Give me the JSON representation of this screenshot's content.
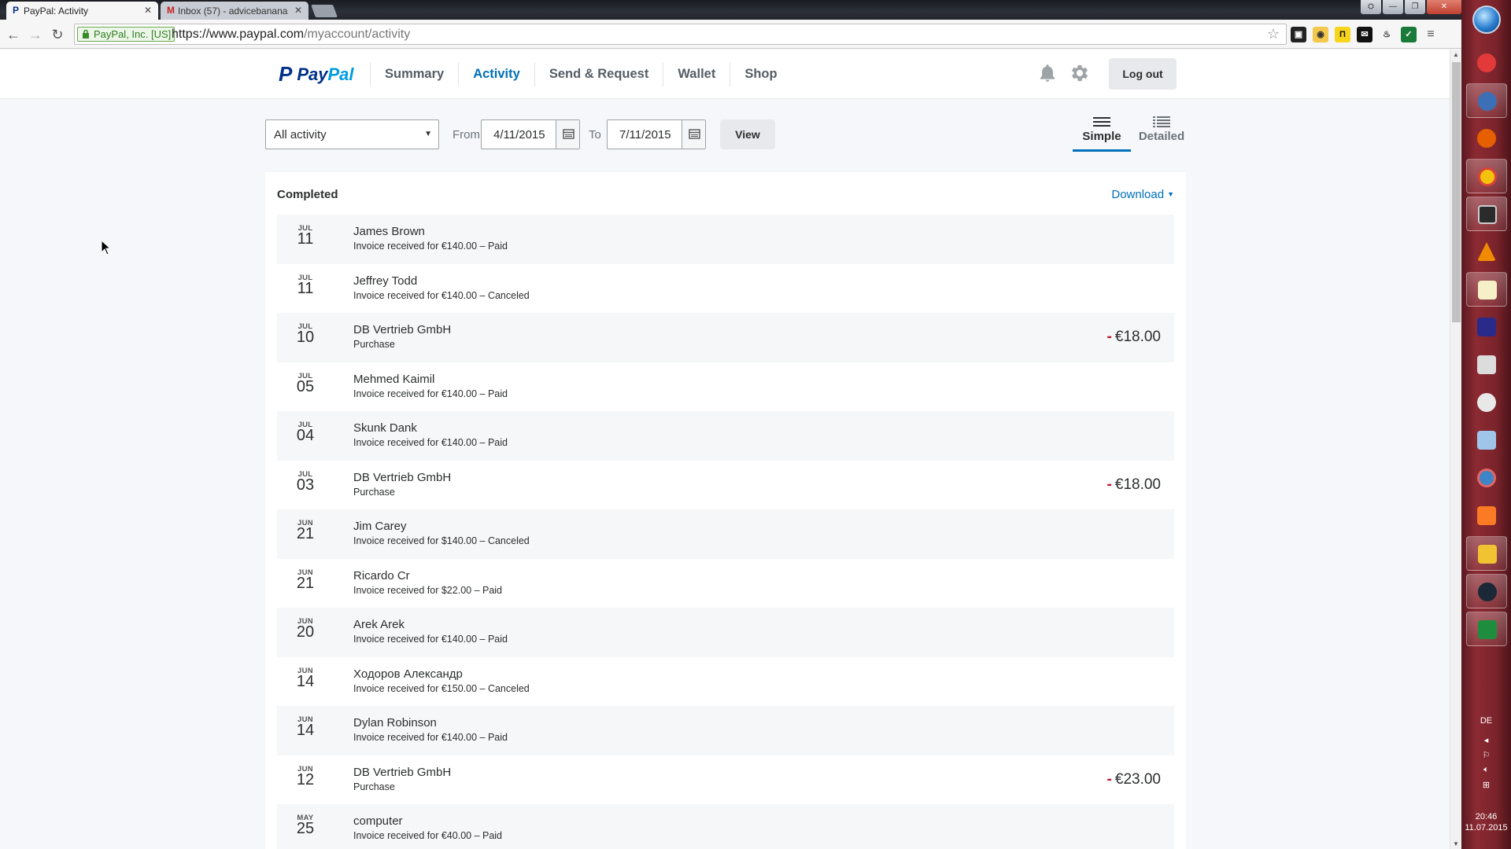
{
  "browser": {
    "tabs": [
      {
        "title": "PayPal: Activity",
        "favicon": "paypal-favicon",
        "active": true
      },
      {
        "title": "Inbox (57) - advicebanana",
        "favicon": "gmail-favicon",
        "active": false
      }
    ],
    "ev_certificate": "PayPal, Inc. [US]",
    "url_host": "https://www.paypal.com",
    "url_path": "/myaccount/activity"
  },
  "header": {
    "logo_text_a": "Pay",
    "logo_text_b": "Pal",
    "nav": [
      "Summary",
      "Activity",
      "Send & Request",
      "Wallet",
      "Shop"
    ],
    "active_nav": "Activity",
    "logout_label": "Log out"
  },
  "filters": {
    "activity_type": "All activity",
    "from_label": "From",
    "from_date": "4/11/2015",
    "to_label": "To",
    "to_date": "7/11/2015",
    "view_label": "View",
    "view_modes": [
      "Simple",
      "Detailed"
    ],
    "active_view_mode": "Simple"
  },
  "activity": {
    "section_title": "Completed",
    "download_label": "Download",
    "transactions": [
      {
        "month": "JUL",
        "day": "11",
        "name": "James Brown",
        "desc": "Invoice received for €140.00 – Paid",
        "amount": ""
      },
      {
        "month": "JUL",
        "day": "11",
        "name": "Jeffrey Todd",
        "desc": "Invoice received for €140.00 – Canceled",
        "amount": ""
      },
      {
        "month": "JUL",
        "day": "10",
        "name": "DB Vertrieb GmbH",
        "desc": "Purchase",
        "amount": "€18.00",
        "sign": "-"
      },
      {
        "month": "JUL",
        "day": "05",
        "name": "Mehmed Kaimil",
        "desc": "Invoice received for €140.00 – Paid",
        "amount": ""
      },
      {
        "month": "JUL",
        "day": "04",
        "name": "Skunk Dank",
        "desc": "Invoice received for €140.00 – Paid",
        "amount": ""
      },
      {
        "month": "JUL",
        "day": "03",
        "name": "DB Vertrieb GmbH",
        "desc": "Purchase",
        "amount": "€18.00",
        "sign": "-"
      },
      {
        "month": "JUN",
        "day": "21",
        "name": "Jim Carey",
        "desc": "Invoice received for $140.00 – Canceled",
        "amount": ""
      },
      {
        "month": "JUN",
        "day": "21",
        "name": "Ricardo Cr",
        "desc": "Invoice received for $22.00 – Paid",
        "amount": ""
      },
      {
        "month": "JUN",
        "day": "20",
        "name": "Arek Arek",
        "desc": "Invoice received for €140.00 – Paid",
        "amount": ""
      },
      {
        "month": "JUN",
        "day": "14",
        "name": "Ходоров Александр",
        "desc": "Invoice received for €150.00 – Canceled",
        "amount": ""
      },
      {
        "month": "JUN",
        "day": "14",
        "name": "Dylan Robinson",
        "desc": "Invoice received for €140.00 – Paid",
        "amount": ""
      },
      {
        "month": "JUN",
        "day": "12",
        "name": "DB Vertrieb GmbH",
        "desc": "Purchase",
        "amount": "€23.00",
        "sign": "-"
      },
      {
        "month": "MAY",
        "day": "25",
        "name": "computer",
        "desc": "Invoice received for €40.00 – Paid",
        "amount": ""
      }
    ]
  },
  "taskbar": {
    "language": "DE",
    "time": "20:46",
    "date": "11.07.2015"
  },
  "colors": {
    "paypal_dark_blue": "#003087",
    "paypal_light_blue": "#009cde",
    "link_blue": "#0070ba",
    "negative_sign": "#c8102e"
  }
}
